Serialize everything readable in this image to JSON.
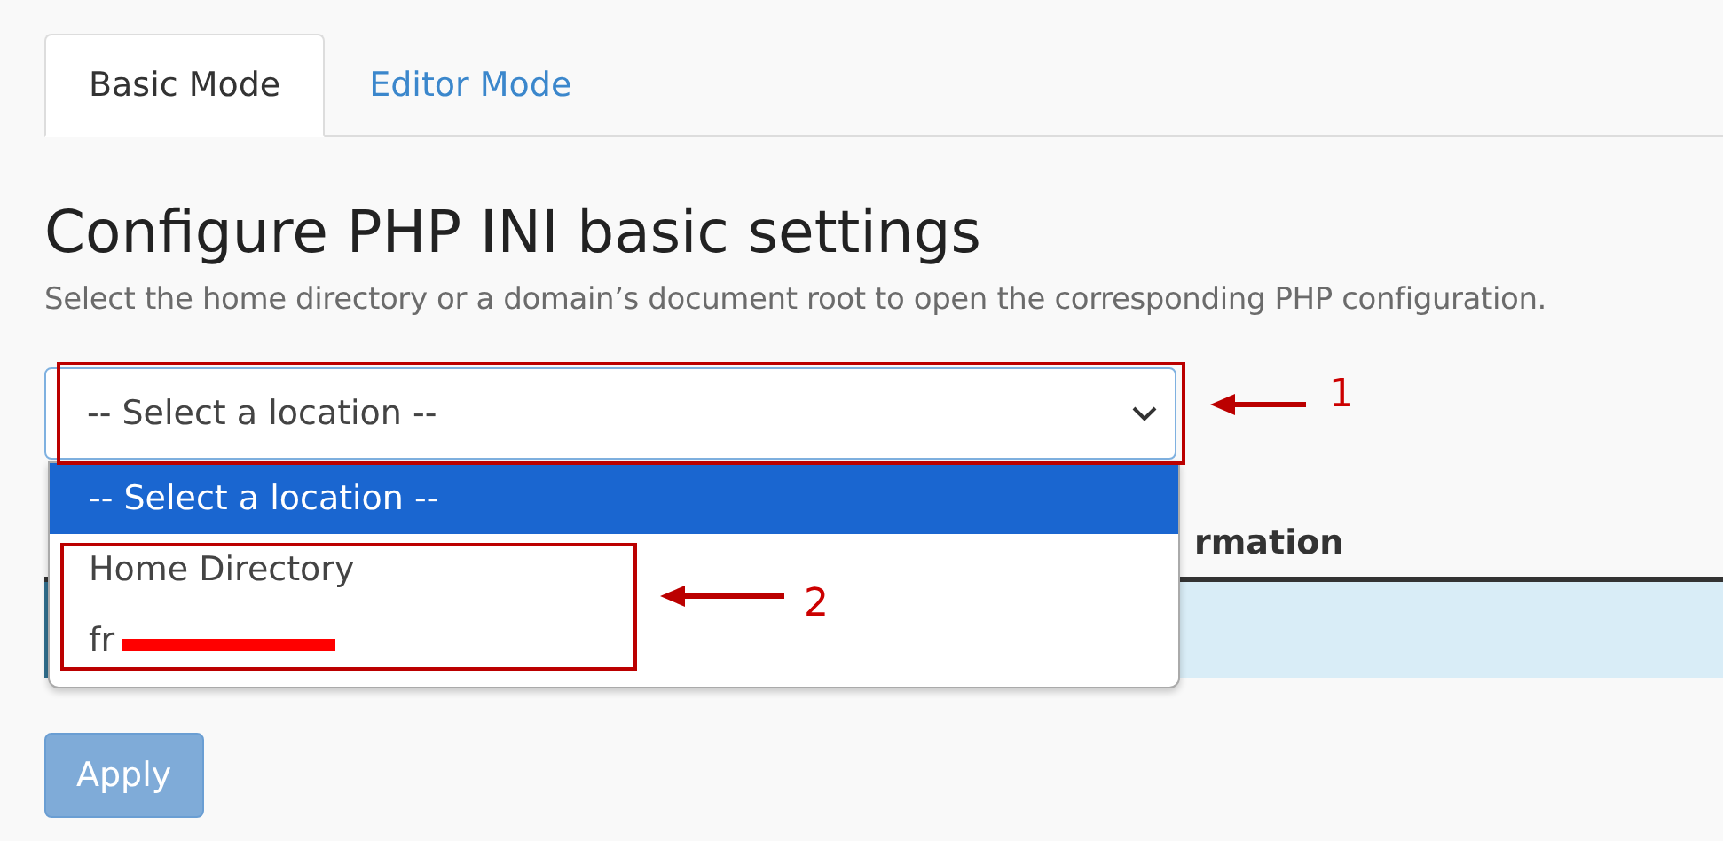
{
  "tabs": [
    {
      "label": "Basic Mode",
      "selected": true
    },
    {
      "label": "Editor Mode",
      "selected": false
    }
  ],
  "heading": "Configure PHP INI basic settings",
  "description": "Select the home directory or a domain’s document root to open the corresponding PHP configuration.",
  "location_select": {
    "value": "-- Select a location --",
    "expanded": true,
    "options": [
      {
        "label": "-- Select a location --",
        "selected": true
      },
      {
        "label": "Home Directory",
        "selected": false
      },
      {
        "label": "fr",
        "selected": false,
        "redacted": true
      }
    ]
  },
  "table": {
    "column_2": "rmation"
  },
  "apply_button": {
    "label": "Apply",
    "disabled": true
  },
  "annotations": [
    {
      "number": "1"
    },
    {
      "number": "2"
    }
  ]
}
